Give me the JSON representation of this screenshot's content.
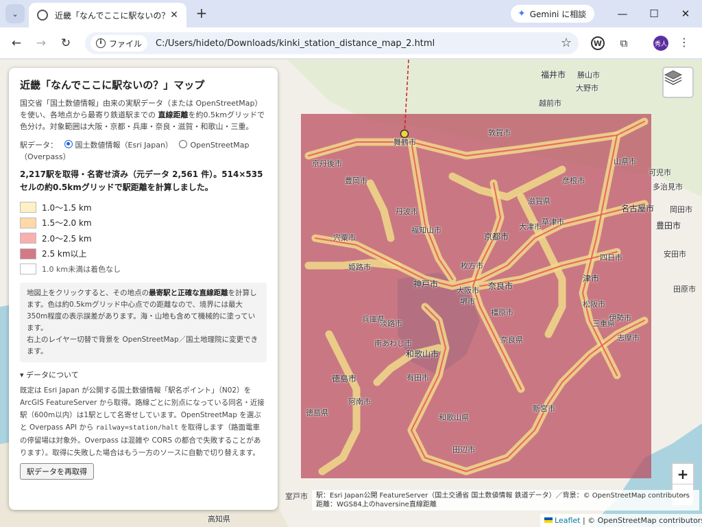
{
  "browser": {
    "tab_title": "近畿「なんでここに駅ないの？」マップ",
    "gemini_label": "Gemini に相談",
    "site_chip": "ファイル",
    "url": "C:/Users/hideto/Downloads/kinki_station_distance_map_2.html",
    "avatar_text": "秀人"
  },
  "panel": {
    "title": "近畿「なんでここに駅ないの？」マップ",
    "intro_1": "国交省「国土数値情報」由来の実駅データ（または OpenStreetMap）を使い、各地点から最寄り鉄道駅までの ",
    "intro_bold": "直線距離",
    "intro_2": "を約0.5kmグリッドで色分け。対象範囲は大阪・京都・兵庫・奈良・滋賀・和歌山・三重。",
    "source_label": "駅データ：",
    "source_option_1": "国土数値情報（Esri Japan）",
    "source_option_2": "OpenStreetMap（Overpass）",
    "status": "2,217駅を取得・名寄せ済み（元データ 2,561 件）。514×535 セルの約0.5kmグリッドで駅距離を計算しました。",
    "legend": [
      {
        "label": "1.0〜1.5 km",
        "color": "#fff1c4"
      },
      {
        "label": "1.5〜2.0 km",
        "color": "#ffd9a8"
      },
      {
        "label": "2.0〜2.5 km",
        "color": "#f7b0ad"
      },
      {
        "label": "2.5 km以上",
        "color": "#d27a86"
      },
      {
        "label": "1.0 km未満は着色なし",
        "color": "#ffffff"
      }
    ],
    "note_1": "地図上をクリックすると、その地点の",
    "note_bold": "最寄駅と正確な直線距離",
    "note_2": "を計算します。色は約0.5kmグリッド中心点での距離なので、境界には最大350m程度の表示誤差があります。海・山地も含めて機械的に塗っています。",
    "note_3": "右上のレイヤー切替で背景を OpenStreetMap／国土地理院に変更できます。",
    "details_summary": "▾ データについて",
    "details_1": "既定は Esri Japan が公開する国土数値情報「駅名ポイント」（N02）を ArcGIS FeatureServer から取得。路線ごとに別点になっている同名・近接駅（600m以内）は1駅として名寄せしています。OpenStreetMap を選ぶと Overpass API から ",
    "details_code": "railway=station/halt",
    "details_2": " を取得します（路面電車の停留場は対象外。Overpass は混雑や CORS の都合で失敗することがあります）。取得に失敗した場合はもう一方のソースに自動で切り替えます。",
    "reload_label": "駅データを再取得"
  },
  "map": {
    "labels": [
      {
        "text": "福井市",
        "big": true
      },
      {
        "text": "勝山市"
      },
      {
        "text": "大野市"
      },
      {
        "text": "越前市"
      },
      {
        "text": "敦賀市"
      },
      {
        "text": "山県市"
      },
      {
        "text": "可児市"
      },
      {
        "text": "多治見市"
      },
      {
        "text": "名古屋市",
        "big": true
      },
      {
        "text": "豊田市",
        "big": true
      },
      {
        "text": "京都市",
        "big": true
      },
      {
        "text": "大津市"
      },
      {
        "text": "滋賀県"
      },
      {
        "text": "草津市"
      },
      {
        "text": "彦根市"
      },
      {
        "text": "四日市"
      },
      {
        "text": "津市",
        "big": true
      },
      {
        "text": "三重県"
      },
      {
        "text": "松阪市"
      },
      {
        "text": "伊勢市"
      },
      {
        "text": "志摩市"
      },
      {
        "text": "奈良市",
        "big": true
      },
      {
        "text": "奈良県"
      },
      {
        "text": "橿原市"
      },
      {
        "text": "大阪市"
      },
      {
        "text": "堺市"
      },
      {
        "text": "枚方市"
      },
      {
        "text": "神戸市",
        "big": true
      },
      {
        "text": "姫路市"
      },
      {
        "text": "兵庫県"
      },
      {
        "text": "宍粟市"
      },
      {
        "text": "丹波市"
      },
      {
        "text": "豊岡市"
      },
      {
        "text": "舞鶴市"
      },
      {
        "text": "京丹後市"
      },
      {
        "text": "福知山市"
      },
      {
        "text": "淡路市"
      },
      {
        "text": "南あわじ市"
      },
      {
        "text": "和歌山市",
        "big": true
      },
      {
        "text": "和歌山県"
      },
      {
        "text": "有田市"
      },
      {
        "text": "田辺市"
      },
      {
        "text": "新宮市"
      },
      {
        "text": "徳島市",
        "big": true
      },
      {
        "text": "徳島県"
      },
      {
        "text": "阿南市"
      },
      {
        "text": "室戸市"
      },
      {
        "text": "高知県"
      },
      {
        "text": "岡田市"
      },
      {
        "text": "安田市"
      },
      {
        "text": "田原市"
      }
    ],
    "station_info": "駅：Esri Japan公開 FeatureServer（国土交通省 国土数値情報 鉄道データ）／背景：© OpenStreetMap contributors",
    "distance_info": "距離：WGS84上のhaversine直線距離",
    "attrib_leaflet": "Leaflet",
    "attrib_rest": " | © OpenStreetMap contributors",
    "zoom_in": "+",
    "zoom_out": "−",
    "colors": {
      "overlay": "#b84a5c",
      "station_halo": "#f1d98a",
      "land": "#f2efe9",
      "water": "#aad3df"
    }
  }
}
